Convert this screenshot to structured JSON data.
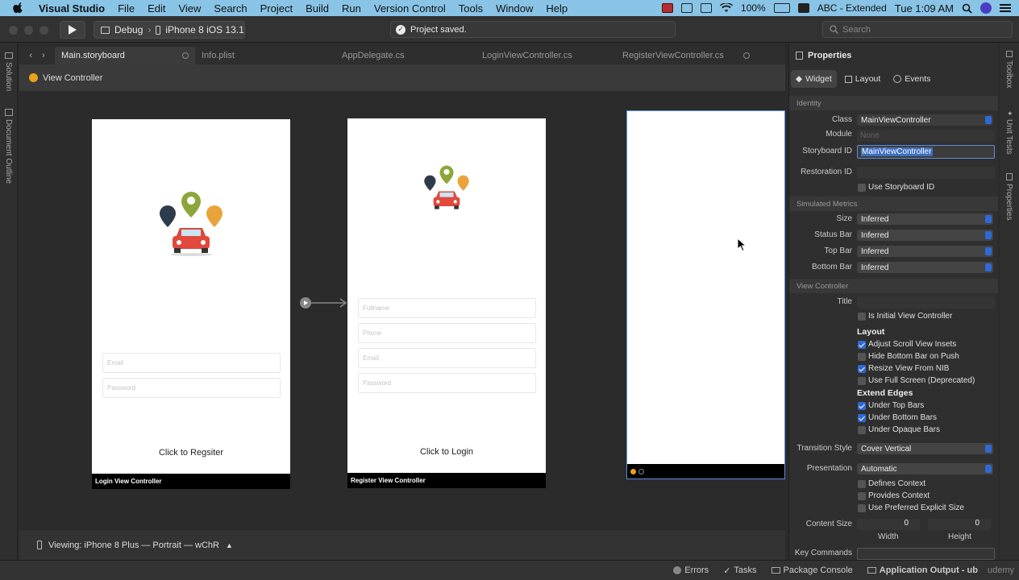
{
  "menubar": {
    "app": "Visual Studio",
    "items": [
      "File",
      "Edit",
      "View",
      "Search",
      "Project",
      "Build",
      "Run",
      "Version Control",
      "Tools",
      "Window",
      "Help"
    ],
    "battery": "100%",
    "input": "ABC - Extended",
    "time": "Tue 1:09 AM"
  },
  "toolbar": {
    "config": "Debug",
    "device": "iPhone 8 iOS 13.1",
    "status": "Project saved.",
    "search_placeholder": "Search"
  },
  "sidebar": {
    "solution": "Solution",
    "outline": "Document Outline"
  },
  "right_sidebar": {
    "toolbox": "Toolbox",
    "unit_tests": "Unit Tests",
    "properties": "Properties"
  },
  "tabs": [
    {
      "label": "Main.storyboard"
    },
    {
      "label": "Info.plist"
    },
    {
      "label": "AppDelegate.cs"
    },
    {
      "label": "LoginViewController.cs"
    },
    {
      "label": "RegisterViewController.cs"
    }
  ],
  "breadcrumb": "View Controller",
  "scenes": {
    "login": {
      "email": "Email",
      "password": "Password",
      "button": "Click to Regsiter",
      "footer": "Login View Controller"
    },
    "register": {
      "fullname": "Fullname",
      "phone": "Phone",
      "email": "Email",
      "password": "Password",
      "button": "Click to Login",
      "footer": "Register View Controller"
    }
  },
  "viewing": "Viewing: iPhone 8 Plus — Portrait — wChR",
  "statusbar": {
    "errors": "Errors",
    "tasks": "Tasks",
    "console": "Package Console",
    "output": "Application Output - ub",
    "watermark": "udemy"
  },
  "properties": {
    "title": "Properties",
    "tabs": [
      "Widget",
      "Layout",
      "Events"
    ],
    "identity": {
      "header": "Identity",
      "class_label": "Class",
      "class_value": "MainViewController",
      "module_label": "Module",
      "module_placeholder": "None",
      "storyboard_label": "Storyboard ID",
      "storyboard_value": "MainViewController",
      "restoration_label": "Restoration ID",
      "use_storyboard": "Use Storyboard ID"
    },
    "simulated": {
      "header": "Simulated Metrics",
      "size_label": "Size",
      "size": "Inferred",
      "status_label": "Status Bar",
      "status": "Inferred",
      "top_label": "Top Bar",
      "top": "Inferred",
      "bottom_label": "Bottom Bar",
      "bottom": "Inferred"
    },
    "vc": {
      "header": "View Controller",
      "title_label": "Title",
      "initial": "Is Initial View Controller",
      "layout_header": "Layout",
      "adjust": "Adjust Scroll View Insets",
      "hide_bottom": "Hide Bottom Bar on Push",
      "resize": "Resize View From NIB",
      "fullscreen": "Use Full Screen (Deprecated)",
      "edges_header": "Extend Edges",
      "under_top": "Under Top Bars",
      "under_bottom": "Under Bottom Bars",
      "under_opaque": "Under Opaque Bars",
      "transition_label": "Transition Style",
      "transition": "Cover Vertical",
      "presentation_label": "Presentation",
      "presentation": "Automatic",
      "defines": "Defines Context",
      "provides": "Provides Context",
      "preferred": "Use Preferred Explicit Size",
      "content_size_label": "Content Size",
      "width_val": "0",
      "height_val": "0",
      "width_label": "Width",
      "height_label": "Height",
      "key_commands": "Key Commands"
    }
  }
}
